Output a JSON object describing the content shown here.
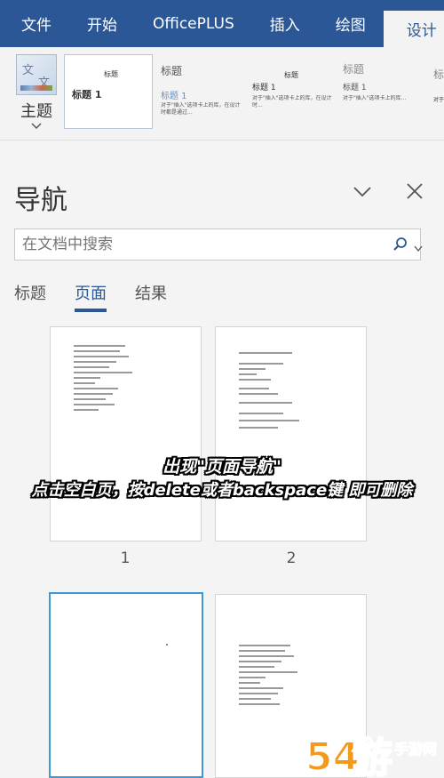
{
  "ribbon": {
    "tabs": [
      {
        "label": "文件"
      },
      {
        "label": "开始"
      },
      {
        "label": "OfficePLUS"
      },
      {
        "label": "插入"
      },
      {
        "label": "绘图"
      },
      {
        "label": "设计"
      }
    ],
    "theme_label": "主题",
    "theme_icon_text": [
      "文",
      "文"
    ],
    "style_thumbs": [
      {
        "small": "标题",
        "heading": "标题 1"
      },
      {
        "title": "标题",
        "sub": "标题 1",
        "body": "对于\"插入\"选项卡上的库，在设计时都是通过..."
      },
      {
        "small": "标题",
        "heading": "标题 1",
        "body": "对于\"插入\"选项卡上的库，在设计时..."
      },
      {
        "title": "标题",
        "sub": "标题 1",
        "body": "对于\"插入\"选项卡上的库..."
      },
      {
        "title": "标",
        "body": "对于"
      }
    ]
  },
  "nav": {
    "title": "导航",
    "search_placeholder": "在文档中搜索",
    "tabs": [
      {
        "label": "标题",
        "active": false
      },
      {
        "label": "页面",
        "active": true
      },
      {
        "label": "结果",
        "active": false
      }
    ],
    "pages": [
      {
        "number": "1",
        "selected": false
      },
      {
        "number": "2",
        "selected": false
      },
      {
        "number": "",
        "selected": true
      },
      {
        "number": "",
        "selected": false
      }
    ]
  },
  "caption": {
    "line1": "出现\"页面导航\"",
    "line2": "点击空白页，按delete或者backspace键 即可删除"
  },
  "watermark": {
    "text": "54游",
    "site": "手游网"
  },
  "colors": {
    "ribbon": "#2b5797",
    "selected_page_border": "#3a9ad9"
  }
}
